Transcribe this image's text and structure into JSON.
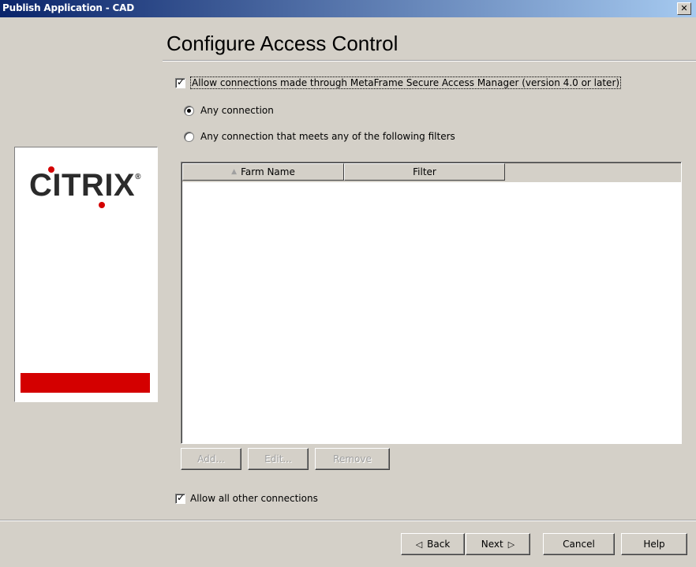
{
  "window": {
    "title": "Publish Application - CAD",
    "close_glyph": "✕"
  },
  "heading": "Configure Access Control",
  "logo": {
    "text": "CITRIX",
    "reg": "®"
  },
  "options": {
    "allow_secure_access": {
      "label": "Allow connections made through MetaFrame Secure Access Manager (version 4.0 or later)",
      "checked": true
    },
    "radio_any": {
      "label": "Any connection",
      "selected": true
    },
    "radio_filters": {
      "label": "Any connection that meets any of the following filters",
      "selected": false
    },
    "allow_all_other": {
      "label": "Allow all other connections",
      "checked": true
    }
  },
  "table": {
    "columns": [
      "Farm Name",
      "Filter"
    ],
    "rows": [],
    "sort_arrow": "▲"
  },
  "table_buttons": {
    "add": "Add...",
    "edit": "Edit...",
    "remove": "Remove"
  },
  "footer_buttons": {
    "back": "Back",
    "next": "Next",
    "cancel": "Cancel",
    "help": "Help",
    "back_arrow": "◁",
    "next_arrow": "▷"
  },
  "colors": {
    "accent_red": "#d40000",
    "titlebar_start": "#0a246a",
    "titlebar_end": "#a6caf0"
  }
}
